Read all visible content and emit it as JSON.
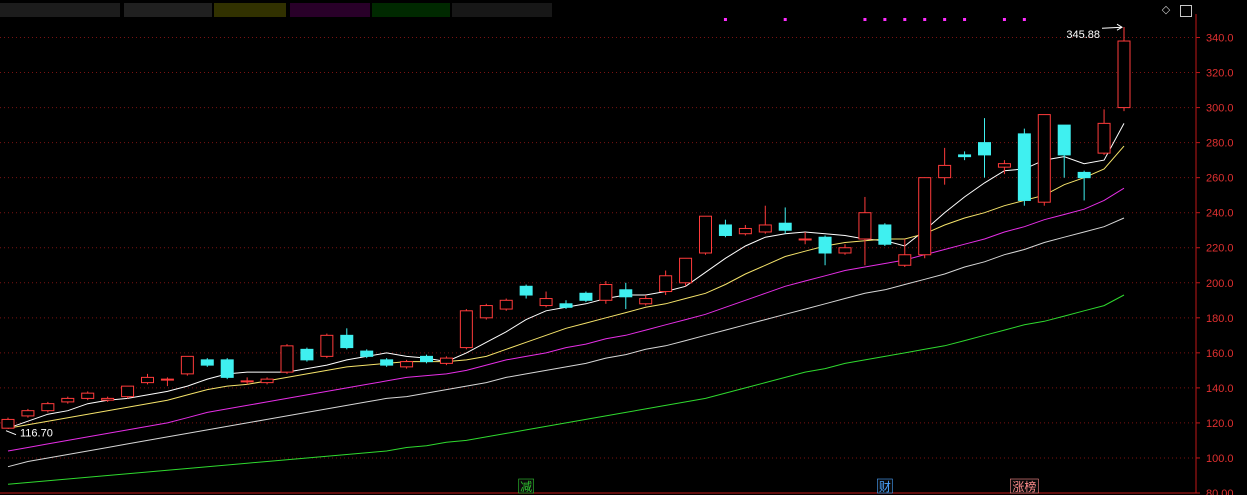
{
  "chart_data": {
    "type": "candlestick",
    "ylim": [
      80,
      350
    ],
    "y_ticks": [
      "80.00",
      "100.0",
      "120.0",
      "140.0",
      "160.0",
      "180.0",
      "200.0",
      "220.0",
      "240.0",
      "260.0",
      "280.0",
      "300.0",
      "320.0",
      "340.0"
    ],
    "y_tick_values": [
      80,
      100,
      120,
      140,
      160,
      180,
      200,
      220,
      240,
      260,
      280,
      300,
      320,
      340
    ],
    "annotations": {
      "high_label": "345.88",
      "high_value": 345.88,
      "low_label": "116.70",
      "low_value": 116.7
    },
    "bottom_markers": [
      {
        "label": "减",
        "index": 26,
        "color": "#2fc42f"
      },
      {
        "label": "财",
        "index": 44,
        "color": "#4aa3ff"
      },
      {
        "label": "涨榜",
        "index": 51,
        "color": "#ff8c8c"
      }
    ],
    "candles": [
      [
        117,
        122,
        116.7,
        123
      ],
      [
        124,
        127,
        123,
        128
      ],
      [
        127,
        131,
        126,
        132
      ],
      [
        132,
        134,
        131,
        135
      ],
      [
        134,
        137,
        133,
        138
      ],
      [
        133,
        134,
        132,
        135
      ],
      [
        135,
        141,
        134,
        141
      ],
      [
        143,
        146,
        142,
        148
      ],
      [
        145,
        145,
        141,
        146
      ],
      [
        148,
        158,
        147,
        158
      ],
      [
        156,
        153,
        152,
        157
      ],
      [
        156,
        146,
        145,
        157
      ],
      [
        144,
        144,
        142,
        146
      ],
      [
        143,
        145,
        142,
        146
      ],
      [
        149,
        164,
        148,
        165
      ],
      [
        162,
        156,
        155,
        163
      ],
      [
        158,
        170,
        157,
        171
      ],
      [
        170,
        163,
        162,
        174
      ],
      [
        161,
        158,
        157,
        162
      ],
      [
        156,
        153,
        152,
        157
      ],
      [
        152,
        155,
        151,
        156
      ],
      [
        158,
        155,
        154,
        159
      ],
      [
        154,
        157,
        153,
        158
      ],
      [
        163,
        184,
        162,
        185
      ],
      [
        180,
        187,
        179,
        188
      ],
      [
        185,
        190,
        184,
        191
      ],
      [
        198,
        193,
        191,
        199
      ],
      [
        187,
        191,
        186,
        195
      ],
      [
        188,
        186,
        185,
        190
      ],
      [
        194,
        190,
        189,
        195
      ],
      [
        190,
        199,
        188,
        201
      ],
      [
        196,
        192,
        185,
        200
      ],
      [
        188,
        191,
        187,
        193
      ],
      [
        195,
        204,
        193,
        207
      ],
      [
        200,
        214,
        198,
        214
      ],
      [
        217,
        238,
        216,
        238
      ],
      [
        233,
        227,
        226,
        236
      ],
      [
        228,
        231,
        227,
        233
      ],
      [
        229,
        233,
        228,
        244
      ],
      [
        234,
        230,
        228,
        243
      ],
      [
        225,
        225,
        222,
        229
      ],
      [
        226,
        217,
        210,
        227
      ],
      [
        217,
        220,
        216,
        222
      ],
      [
        225,
        240,
        210,
        249
      ],
      [
        233,
        222,
        221,
        234
      ],
      [
        210,
        216,
        209,
        225
      ],
      [
        216,
        260,
        214,
        260
      ],
      [
        260,
        267,
        256,
        277
      ],
      [
        273,
        272,
        270,
        275
      ],
      [
        280,
        273,
        260,
        294
      ],
      [
        266,
        268,
        262,
        270
      ],
      [
        285,
        247,
        244,
        288
      ],
      [
        246,
        296,
        244,
        296
      ],
      [
        290,
        273,
        260,
        290
      ],
      [
        263,
        260,
        247,
        264
      ],
      [
        274,
        291,
        273,
        299
      ],
      [
        300,
        338,
        298,
        346
      ]
    ],
    "series": [
      {
        "color": "#ffffff",
        "values": [
          117,
          121,
          125,
          127,
          131,
          133,
          134,
          136,
          138,
          141,
          145,
          148,
          149,
          149,
          149,
          151,
          153,
          156,
          158,
          160,
          158,
          157,
          155,
          160,
          166,
          172,
          179,
          184,
          186,
          188,
          191,
          193,
          193,
          195,
          198,
          206,
          214,
          221,
          226,
          228,
          229,
          228,
          227,
          225,
          224,
          221,
          230,
          240,
          249,
          257,
          264,
          265,
          270,
          272,
          268,
          270,
          291
        ]
      },
      {
        "color": "#f5e36a",
        "values": [
          117,
          119,
          121,
          123,
          125,
          127,
          129,
          131,
          133,
          136,
          139,
          141,
          142,
          144,
          146,
          148,
          150,
          152,
          153,
          154,
          155,
          155,
          155,
          156,
          158,
          162,
          166,
          170,
          174,
          177,
          180,
          183,
          186,
          188,
          191,
          194,
          199,
          205,
          210,
          215,
          218,
          221,
          223,
          224,
          225,
          225,
          228,
          233,
          237,
          240,
          244,
          247,
          250,
          256,
          260,
          265,
          278
        ]
      },
      {
        "color": "#e62ee6",
        "values": [
          104,
          106,
          108,
          110,
          112,
          114,
          116,
          118,
          120,
          123,
          126,
          128,
          130,
          132,
          134,
          136,
          138,
          140,
          142,
          144,
          146,
          147,
          148,
          150,
          153,
          156,
          158,
          160,
          163,
          165,
          168,
          170,
          173,
          176,
          179,
          182,
          186,
          190,
          194,
          198,
          201,
          204,
          207,
          209,
          211,
          213,
          216,
          219,
          222,
          225,
          229,
          232,
          236,
          239,
          242,
          247,
          254
        ]
      },
      {
        "color": "#d6d6d6",
        "values": [
          95,
          98,
          100,
          102,
          104,
          106,
          108,
          110,
          112,
          114,
          116,
          118,
          120,
          122,
          124,
          126,
          128,
          130,
          132,
          134,
          135,
          137,
          139,
          141,
          143,
          146,
          148,
          150,
          152,
          154,
          157,
          159,
          162,
          164,
          167,
          170,
          173,
          176,
          179,
          182,
          185,
          188,
          191,
          194,
          196,
          199,
          202,
          205,
          209,
          212,
          216,
          219,
          223,
          226,
          229,
          232,
          237
        ]
      },
      {
        "color": "#2fd92f",
        "values": [
          85,
          86,
          87,
          88,
          89,
          90,
          91,
          92,
          93,
          94,
          95,
          96,
          97,
          98,
          99,
          100,
          101,
          102,
          103,
          104,
          106,
          107,
          109,
          110,
          112,
          114,
          116,
          118,
          120,
          122,
          124,
          126,
          128,
          130,
          132,
          134,
          137,
          140,
          143,
          146,
          149,
          151,
          154,
          156,
          158,
          160,
          162,
          164,
          167,
          170,
          173,
          176,
          178,
          181,
          184,
          187,
          193
        ]
      }
    ]
  }
}
